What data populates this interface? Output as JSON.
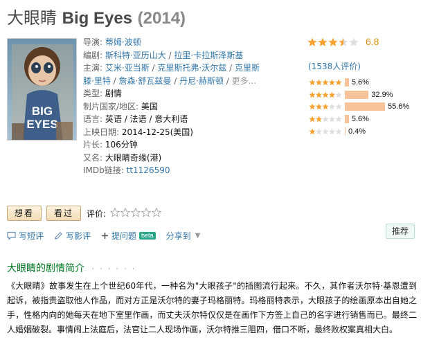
{
  "title": {
    "cn": "大眼睛",
    "en": "Big Eyes",
    "year": "(2014)"
  },
  "poster": {
    "text": "BIG EYES"
  },
  "info": {
    "director_label": "导演:",
    "directors": [
      "蒂姆·波顿"
    ],
    "writer_label": "编剧:",
    "writers": [
      "斯科特·亚历山大",
      "拉里·卡拉斯泽斯基"
    ],
    "cast_label": "主演:",
    "cast_line1": [
      "艾米·亚当斯",
      "克里斯托弗·沃尔兹",
      "克里斯"
    ],
    "cast_line2": [
      "滕·里特",
      "詹森·舒瓦兹曼",
      "丹尼·赫斯顿"
    ],
    "cast_more": "更多...",
    "genre_label": "类型:",
    "genre": "剧情",
    "country_label": "制片国家/地区:",
    "country": "美国",
    "language_label": "语言:",
    "language": "英语 / 法语 / 意大利语",
    "release_label": "上映日期:",
    "release": "2014-12-25(美国)",
    "runtime_label": "片长:",
    "runtime": "106分钟",
    "aka_label": "又名:",
    "aka": "大眼睛奇缘(港)",
    "imdb_label": "IMDb链接:",
    "imdb": "tt1126590"
  },
  "rating": {
    "score": "6.8",
    "stars": 3.5,
    "count_text": "(1538人评价)",
    "distribution": [
      {
        "stars": 5,
        "percent": 5.6,
        "label": "5.6%"
      },
      {
        "stars": 4,
        "percent": 32.9,
        "label": "32.9%"
      },
      {
        "stars": 3,
        "percent": 55.6,
        "label": "55.6%"
      },
      {
        "stars": 2,
        "percent": 5.6,
        "label": "5.6%"
      },
      {
        "stars": 1,
        "percent": 0.4,
        "label": "0.4%"
      }
    ]
  },
  "buttons": {
    "want": "想看",
    "seen": "看过",
    "rate_label": "评价:"
  },
  "actions": {
    "short_review": "写短评",
    "review": "写影评",
    "question": "提问题",
    "beta": "beta",
    "share": "分享到",
    "recommend": "推荐"
  },
  "summary": {
    "title": "大眼睛的剧情简介",
    "dots": "· · · · · ·",
    "text": "《大眼睛》故事发生在上个世纪60年代，一种名为\"大眼孩子\"的插图流行起来。不久，其作者沃尔特·基恩遭到起诉，被指责盗取他人作品，而对方正是沃尔特的妻子玛格丽特。玛格丽特表示，大眼孩子的绘画原本出自她之手，性格内向的她每天在地下室里作画，而丈夫沃尔特仅仅是在画作下方签上自己的名字进行销售而已。最终二人婚姻破裂。事情闹上法庭后，法官让二人现场作画，沃尔特推三阻四，借口不断，最终败权案真相大白。"
  },
  "colors": {
    "link": "#3377aa",
    "star": "#f7a12f",
    "bar": "#f7c39a",
    "section": "#007722"
  }
}
